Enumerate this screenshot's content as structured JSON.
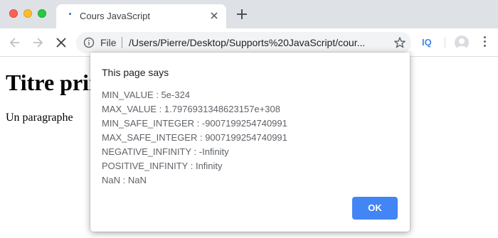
{
  "tab": {
    "title": "Cours JavaScript",
    "close_icon": "close-icon",
    "new_tab_icon": "plus-icon"
  },
  "toolbar": {
    "scheme_label": "File",
    "url": "/Users/Pierre/Desktop/Supports%20JavaScript/cour...",
    "extension_label": "IQ"
  },
  "page": {
    "heading": "Titre principal",
    "paragraph": "Un paragraphe"
  },
  "dialog": {
    "title": "This page says",
    "lines": [
      "MIN_VALUE : 5e-324",
      "MAX_VALUE : 1.7976931348623157e+308",
      "MIN_SAFE_INTEGER : -9007199254740991",
      "MAX_SAFE_INTEGER : 9007199254740991",
      "NEGATIVE_INFINITY : -Infinity",
      "POSITIVE_INFINITY : Infinity",
      "NaN : NaN"
    ],
    "ok_label": "OK"
  },
  "colors": {
    "accent": "#4285f4",
    "tabstrip": "#dee1e6",
    "omnibox": "#f1f3f4"
  }
}
